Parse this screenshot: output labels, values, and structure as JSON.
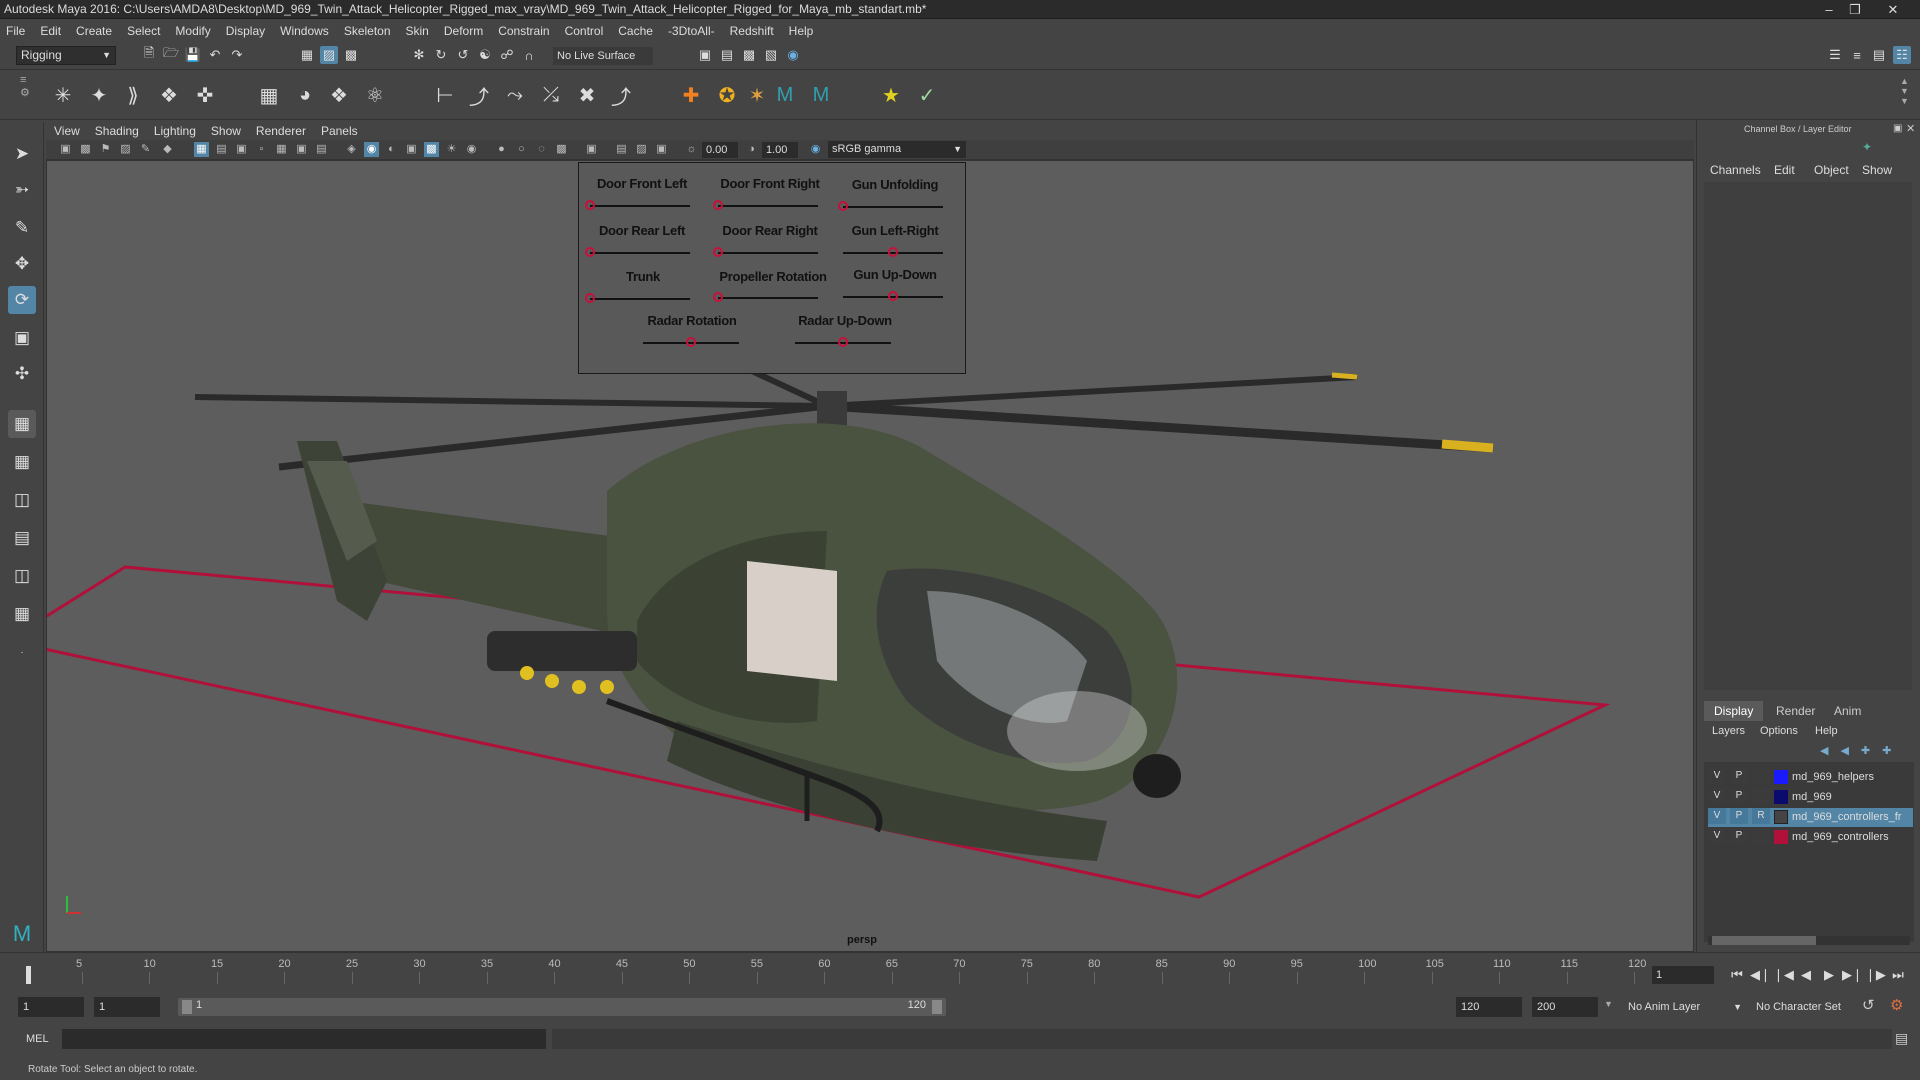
{
  "titlebar": {
    "title": "Autodesk Maya 2016: C:\\Users\\AMDA8\\Desktop\\MD_969_Twin_Attack_Helicopter_Rigged_max_vray\\MD_969_Twin_Attack_Helicopter_Rigged_for_Maya_mb_standart.mb*"
  },
  "menubar": [
    "File",
    "Edit",
    "Create",
    "Select",
    "Modify",
    "Display",
    "Windows",
    "Skeleton",
    "Skin",
    "Deform",
    "Constrain",
    "Control",
    "Cache",
    "-3DtoAll-",
    "Redshift",
    "Help"
  ],
  "statusline": {
    "menuset": "Rigging",
    "live_surface": "No Live Surface"
  },
  "viewport": {
    "menu": [
      "View",
      "Shading",
      "Lighting",
      "Show",
      "Renderer",
      "Panels"
    ],
    "exposure": "0.00",
    "gamma": "1.00",
    "colorspace": "sRGB gamma",
    "camera": "persp"
  },
  "control_panel": {
    "labels": [
      "Door Front Left",
      "Door Front Right",
      "Gun Unfolding",
      "Door Rear Left",
      "Door Rear Right",
      "Gun Left-Right",
      "Trunk",
      "Propeller Rotation",
      "Gun Up-Down",
      "Radar Rotation",
      "Radar Up-Down"
    ],
    "knob_positions": [
      0.0,
      0.0,
      0.0,
      0.0,
      0.0,
      0.5,
      0.0,
      0.0,
      0.5,
      0.5,
      0.5
    ]
  },
  "channelbox": {
    "title": "Channel Box / Layer Editor",
    "menu": [
      "Channels",
      "Edit",
      "Object",
      "Show"
    ],
    "layer_tabs": [
      "Display",
      "Render",
      "Anim"
    ],
    "layer_menu": [
      "Layers",
      "Options",
      "Help"
    ],
    "layers": [
      {
        "v": "V",
        "p": "P",
        "r": "",
        "name": "md_969_helpers",
        "color": "#1a1aff"
      },
      {
        "v": "V",
        "p": "P",
        "r": "",
        "name": "md_969",
        "color": "#0b0b6e"
      },
      {
        "v": "V",
        "p": "P",
        "r": "R",
        "name": "md_969_controllers_fr",
        "color": "#444444"
      },
      {
        "v": "V",
        "p": "P",
        "r": "",
        "name": "md_969_controllers",
        "color": "#b0103a"
      }
    ]
  },
  "timeslider": {
    "ticks": [
      "1",
      "5",
      "10",
      "15",
      "20",
      "25",
      "30",
      "35",
      "40",
      "45",
      "50",
      "55",
      "60",
      "65",
      "70",
      "75",
      "80",
      "85",
      "90",
      "95",
      "100",
      "105",
      "110",
      "115",
      "120"
    ],
    "current_frame": "1"
  },
  "range": {
    "start": "1",
    "playback_start": "1",
    "slider_start": "1",
    "slider_end": "120",
    "playback_end": "120",
    "end": "200",
    "anim_layer": "No Anim Layer",
    "char_set": "No Character Set"
  },
  "cmdline": {
    "label": "MEL"
  },
  "helpline": {
    "text": "Rotate Tool: Select an object to rotate."
  },
  "colors": {
    "accent": "#5285a6",
    "knob": "#c8103a",
    "ground_plane": "#b0103a",
    "helicopter": "#4a5240"
  }
}
